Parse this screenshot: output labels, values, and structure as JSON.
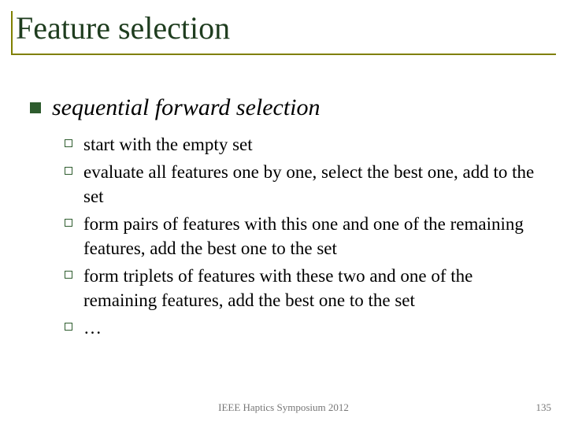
{
  "title": "Feature selection",
  "main_bullet": "sequential forward selection",
  "sub_bullets": [
    "start with the empty set",
    "evaluate all features one by one, select the best one, add to the set",
    "form pairs of features with this one and one of the remaining features, add the best one to the set",
    "form triplets of features with these two and one of the remaining features, add the best one to the set",
    "…"
  ],
  "footer": {
    "center": "IEEE Haptics Symposium 2012",
    "page": "135"
  }
}
